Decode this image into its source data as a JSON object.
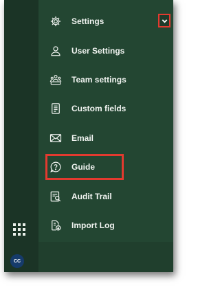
{
  "menu": {
    "items": [
      {
        "id": "settings",
        "label": "Settings",
        "icon": "gear-icon"
      },
      {
        "id": "user-settings",
        "label": "User Settings",
        "icon": "user-icon"
      },
      {
        "id": "team-settings",
        "label": "Team settings",
        "icon": "team-icon"
      },
      {
        "id": "custom-fields",
        "label": "Custom fields",
        "icon": "document-list-icon"
      },
      {
        "id": "email",
        "label": "Email",
        "icon": "envelope-icon"
      },
      {
        "id": "guide",
        "label": "Guide",
        "icon": "help-circle-icon"
      },
      {
        "id": "audit-trail",
        "label": "Audit Trail",
        "icon": "audit-log-icon"
      },
      {
        "id": "import-log",
        "label": "Import Log",
        "icon": "import-file-icon"
      }
    ],
    "expand_icon": "chevron-down-icon"
  },
  "rail": {
    "apps_icon": "grid-apps-icon",
    "avatar_initials": "CC"
  },
  "colors": {
    "panel_bg": "#234632",
    "rail_bg": "#1b3426",
    "text": "#f1f4f1",
    "annotation_red": "#e23a2f",
    "avatar_bg": "#163b6b"
  }
}
